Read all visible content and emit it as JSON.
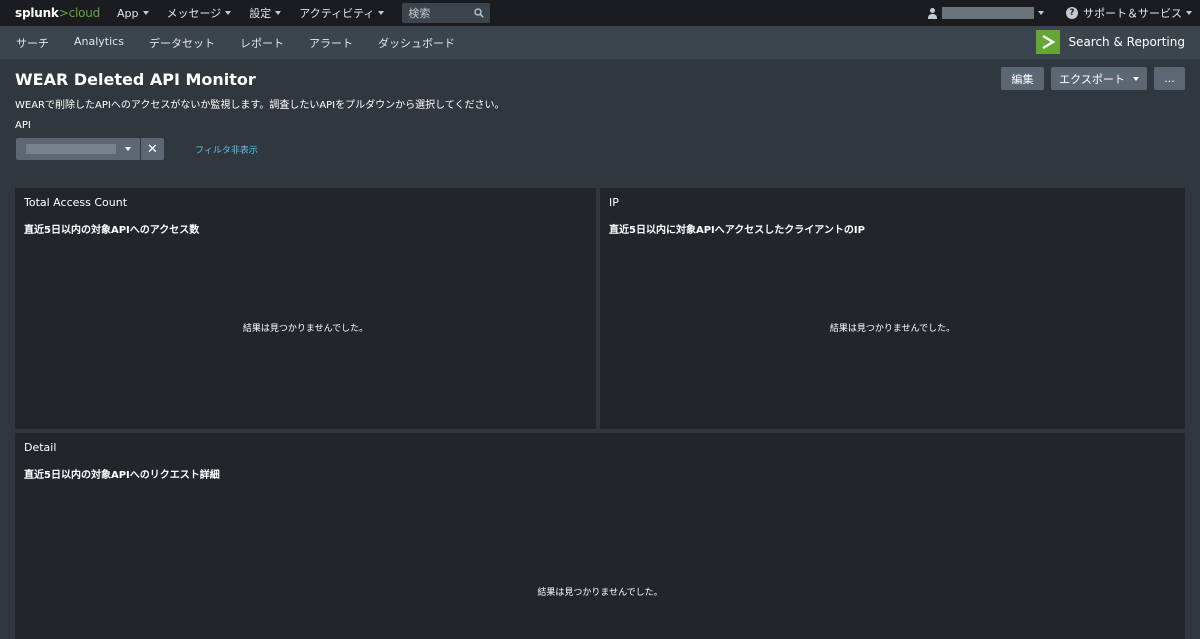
{
  "topbar": {
    "logo_main": "splunk",
    "logo_gt": ">",
    "logo_cloud": "cloud",
    "menu": [
      {
        "label": "App"
      },
      {
        "label": "メッセージ"
      },
      {
        "label": "設定"
      },
      {
        "label": "アクティビティ"
      }
    ],
    "search_placeholder": "検索",
    "support_label": "サポート＆サービス"
  },
  "appbar": {
    "nav": [
      {
        "label": "サーチ"
      },
      {
        "label": "Analytics"
      },
      {
        "label": "データセット"
      },
      {
        "label": "レポート"
      },
      {
        "label": "アラート"
      },
      {
        "label": "ダッシュボード"
      }
    ],
    "app_name": "Search & Reporting"
  },
  "dashboard": {
    "title": "WEAR Deleted API Monitor",
    "description": "WEARで削除したAPIへのアクセスがないか監視します。調査したいAPIをプルダウンから選択してください。",
    "edit_label": "編集",
    "export_label": "エクスポート",
    "more_label": "..."
  },
  "filter": {
    "label": "API",
    "clear_symbol": "✕",
    "hide_filters_label": "フィルタ非表示"
  },
  "panels": {
    "total": {
      "title": "Total Access Count",
      "subtitle": "直近5日以内の対象APIへのアクセス数",
      "empty": "結果は見つかりませんでした。"
    },
    "ip": {
      "title": "IP",
      "subtitle": "直近5日以内に対象APIへアクセスしたクライアントのIP",
      "empty": "結果は見つかりませんでした。"
    },
    "detail": {
      "title": "Detail",
      "subtitle": "直近5日以内の対象APIへのリクエスト詳細",
      "empty": "結果は見つかりませんでした。"
    }
  },
  "colors": {
    "accent_green": "#65a637",
    "link_blue": "#5cc0f2",
    "panel_bg": "#22262b",
    "page_bg": "#31373e"
  }
}
